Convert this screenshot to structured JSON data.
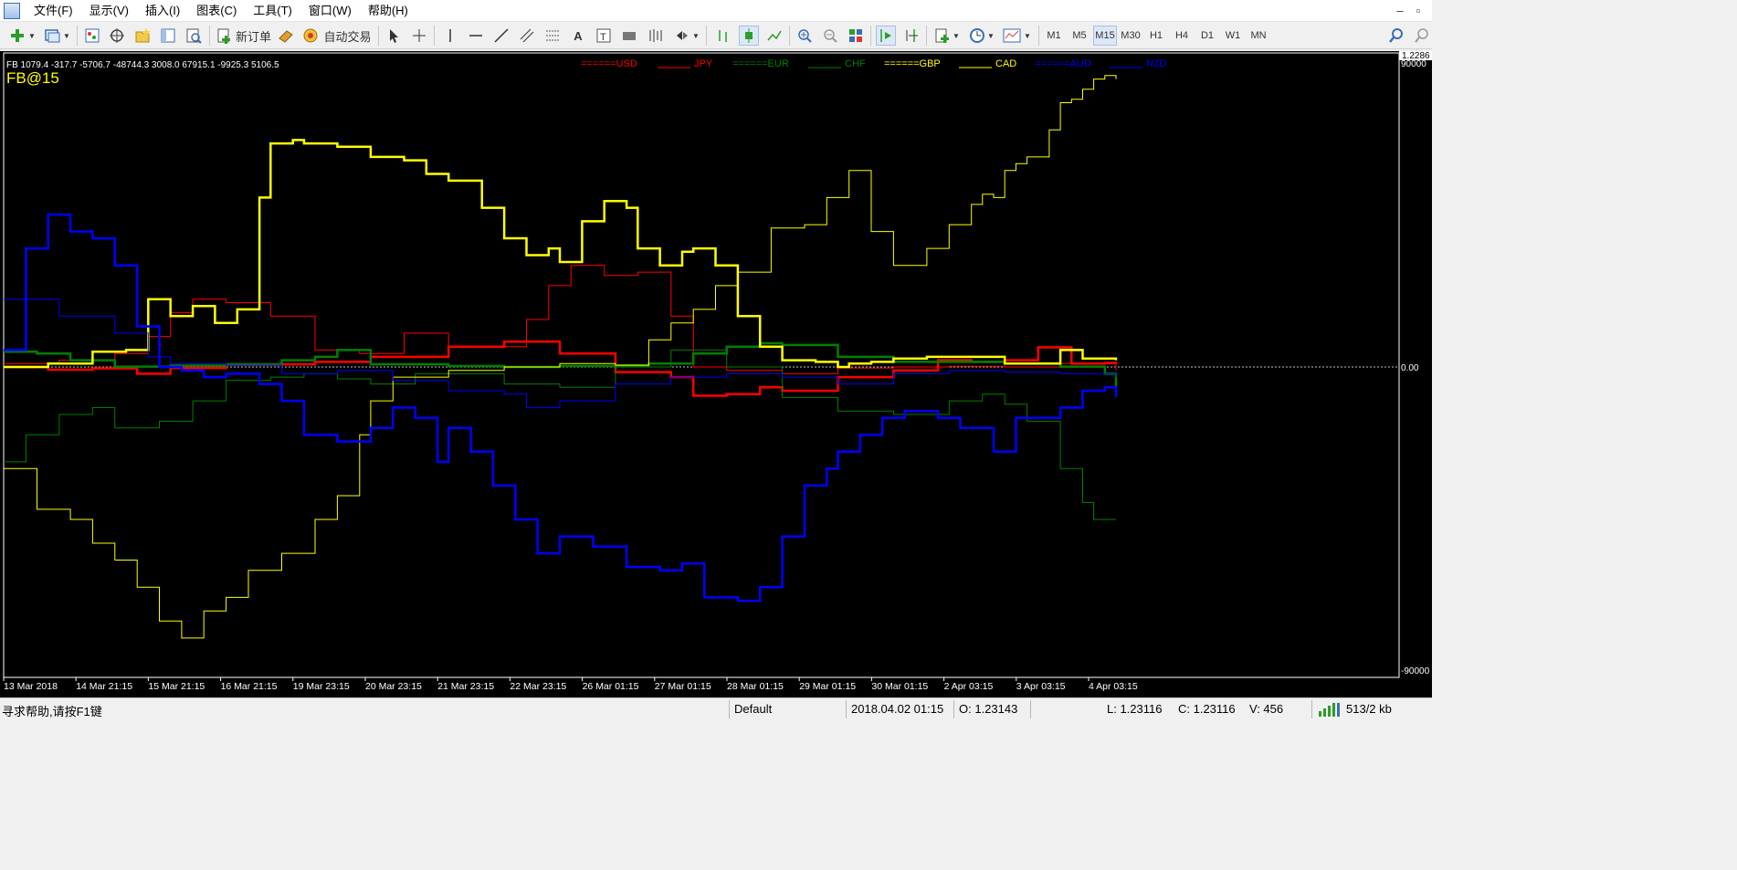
{
  "menus": [
    "文件(F)",
    "显示(V)",
    "插入(I)",
    "图表(C)",
    "工具(T)",
    "窗口(W)",
    "帮助(H)"
  ],
  "window_controls": {
    "minimize": "–",
    "restore": "▫",
    "close": "×"
  },
  "toolbar": {
    "new_order_label": "新订单",
    "auto_trade_label": "自动交易",
    "timeframes": [
      "M1",
      "M5",
      "M15",
      "M30",
      "H1",
      "H4",
      "D1",
      "W1",
      "MN"
    ],
    "active_timeframe": "M15"
  },
  "indicator_header": "FB 1079.4 -317.7 -5706.7 -48744.3 3008.0 67915.1 -9925.3 5106.5",
  "symbol_label": "FB@15",
  "colors": {
    "background": "#000000",
    "usd": "#ff0000",
    "jpy": "#ff0000",
    "eur": "#008000",
    "chf": "#008000",
    "gbp": "#ffff00",
    "cad": "#ffff00",
    "aud": "#0000ff",
    "nzd": "#0000ff",
    "axis_text": "#ffffff"
  },
  "legend": [
    {
      "label": "======USD",
      "color": "#ff0000",
      "style": "marker"
    },
    {
      "label": "JPY",
      "color": "#ff0000",
      "style": "line"
    },
    {
      "label": "======EUR",
      "color": "#008000",
      "style": "marker"
    },
    {
      "label": "CHF",
      "color": "#008000",
      "style": "line"
    },
    {
      "label": "======GBP",
      "color": "#ffff00",
      "style": "marker"
    },
    {
      "label": "CAD",
      "color": "#ffff00",
      "style": "line"
    },
    {
      "label": "======AUD",
      "color": "#0000ff",
      "style": "marker"
    },
    {
      "label": "NZD",
      "color": "#0000ff",
      "style": "line"
    }
  ],
  "price_axis": {
    "top_value": "1.2286",
    "upper": "90000",
    "zero": "0.00",
    "lower": "-90000"
  },
  "chart_data": {
    "type": "line",
    "ylim": [
      -90000,
      90000
    ],
    "x_ticks": [
      "13 Mar 2018",
      "14 Mar 21:15",
      "15 Mar 21:15",
      "16 Mar 21:15",
      "19 Mar 23:15",
      "20 Mar 23:15",
      "21 Mar 23:15",
      "22 Mar 23:15",
      "26 Mar 01:15",
      "27 Mar 01:15",
      "28 Mar 01:15",
      "29 Mar 01:15",
      "30 Mar 01:15",
      "2 Apr 03:15",
      "3 Apr 03:15",
      "4 Apr 03:15"
    ],
    "series": [
      {
        "name": "USD",
        "color": "#ff0000",
        "width": "thick",
        "x": [
          0,
          4,
          8,
          12,
          15,
          20,
          25,
          28,
          33,
          40,
          45,
          50,
          55,
          60,
          62,
          65,
          68,
          70,
          75,
          80,
          84,
          87,
          90,
          93,
          96,
          99,
          100
        ],
        "y": [
          0,
          -800,
          -400,
          -2000,
          -300,
          600,
          800,
          1500,
          3000,
          6000,
          7500,
          4000,
          -1500,
          -3000,
          -8500,
          -8000,
          -6000,
          -7000,
          -3000,
          -1000,
          2000,
          1500,
          2000,
          5800,
          1000,
          1200,
          1000
        ]
      },
      {
        "name": "JPY",
        "color": "#ff0000",
        "width": "thin",
        "x": [
          0,
          5,
          10,
          13,
          15,
          17,
          20,
          24,
          28,
          32,
          36,
          40,
          44,
          47,
          49,
          51,
          54,
          57,
          60,
          62,
          65,
          70,
          75,
          80,
          85,
          90,
          95,
          100
        ],
        "y": [
          1000,
          2000,
          4000,
          9000,
          16000,
          20000,
          19000,
          15000,
          5000,
          4000,
          10000,
          6000,
          6000,
          14000,
          24000,
          30000,
          27000,
          28000,
          15000,
          0,
          -1000,
          -2000,
          -300,
          0,
          200,
          0,
          1000,
          -1000
        ]
      },
      {
        "name": "EUR",
        "color": "#008000",
        "width": "thick",
        "x": [
          0,
          3,
          6,
          10,
          15,
          20,
          25,
          28,
          30,
          33,
          40,
          45,
          50,
          55,
          58,
          62,
          65,
          68,
          70,
          75,
          80,
          85,
          90,
          95,
          99,
          100
        ],
        "y": [
          4500,
          4000,
          2000,
          100,
          400,
          800,
          2000,
          3000,
          5000,
          800,
          300,
          0,
          300,
          500,
          1000,
          4000,
          6000,
          7000,
          6500,
          3000,
          1500,
          1500,
          1000,
          100,
          -2000,
          -6000
        ]
      },
      {
        "name": "CHF",
        "color": "#008000",
        "width": "thin",
        "x": [
          0,
          2,
          5,
          8,
          10,
          14,
          17,
          20,
          24,
          27,
          30,
          33,
          37,
          40,
          45,
          50,
          55,
          60,
          65,
          70,
          75,
          80,
          85,
          88,
          90,
          92,
          95,
          97,
          98,
          100
        ],
        "y": [
          -28000,
          -20000,
          -14000,
          -12000,
          -18000,
          -16000,
          -10000,
          -4000,
          -3000,
          -2000,
          -3500,
          -5000,
          -2000,
          -2000,
          -5000,
          -6000,
          0,
          5000,
          0,
          -9000,
          -13000,
          -14000,
          -10000,
          -8000,
          -11000,
          -16000,
          -30000,
          -40000,
          -45000,
          -45000
        ]
      },
      {
        "name": "GBP",
        "color": "#ffff00",
        "width": "thick",
        "x": [
          0,
          4,
          8,
          11,
          13,
          15,
          17,
          19,
          21,
          23,
          24,
          26,
          27,
          30,
          33,
          36,
          38,
          40,
          43,
          45,
          47,
          49,
          50,
          52,
          54,
          56,
          57,
          59,
          61,
          62,
          64,
          66,
          68,
          70,
          73,
          75,
          76,
          78,
          80,
          83,
          90,
          95,
          97,
          100
        ],
        "y": [
          0,
          1000,
          4500,
          5000,
          20000,
          15000,
          18000,
          13000,
          17000,
          50000,
          66000,
          67000,
          66000,
          65000,
          62000,
          61000,
          57000,
          55000,
          47000,
          38000,
          33000,
          35000,
          31000,
          43000,
          49000,
          47000,
          35000,
          30000,
          34000,
          35000,
          30000,
          15000,
          6000,
          2000,
          1500,
          0,
          1000,
          1500,
          2500,
          3000,
          1000,
          5000,
          2500,
          2000
        ]
      },
      {
        "name": "CAD",
        "color": "#ffff00",
        "width": "thin",
        "x": [
          0,
          3,
          6,
          8,
          10,
          12,
          14,
          16,
          18,
          20,
          22,
          25,
          28,
          30,
          32,
          33,
          35,
          40,
          45,
          50,
          55,
          58,
          60,
          62,
          64,
          66,
          69,
          72,
          74,
          76,
          78,
          80,
          83,
          85,
          87,
          88,
          89,
          90,
          91,
          92,
          94,
          95,
          96,
          97,
          98,
          99,
          100
        ],
        "y": [
          -30000,
          -42000,
          -45000,
          -52000,
          -57000,
          -65000,
          -75000,
          -80000,
          -72000,
          -68000,
          -60000,
          -55000,
          -45000,
          -38000,
          -20000,
          -10000,
          -3000,
          -1000,
          0,
          1000,
          500,
          8000,
          13000,
          17000,
          24000,
          28000,
          41000,
          42000,
          50000,
          58000,
          40000,
          30000,
          35000,
          42000,
          48000,
          51000,
          50000,
          58000,
          60000,
          62000,
          70000,
          78000,
          79000,
          82000,
          85000,
          86000,
          85000
        ]
      },
      {
        "name": "AUD",
        "color": "#0000ff",
        "width": "thick",
        "x": [
          0,
          2,
          4,
          6,
          8,
          10,
          12,
          14,
          16,
          18,
          20,
          23,
          25,
          27,
          30,
          33,
          35,
          37,
          39,
          40,
          42,
          44,
          46,
          48,
          50,
          53,
          56,
          59,
          61,
          63,
          66,
          68,
          70,
          72,
          74,
          75,
          77,
          79,
          81,
          84,
          86,
          89,
          91,
          93,
          95,
          97,
          99,
          100
        ],
        "y": [
          5000,
          35000,
          45000,
          40000,
          38000,
          30000,
          12000,
          0,
          -1000,
          -3000,
          -2000,
          -5000,
          -10000,
          -20000,
          -22000,
          -18000,
          -12000,
          -15000,
          -28000,
          -18000,
          -25000,
          -35000,
          -45000,
          -55000,
          -50000,
          -53000,
          -59000,
          -60000,
          -58000,
          -68000,
          -69000,
          -65000,
          -50000,
          -35000,
          -30000,
          -25000,
          -20000,
          -15000,
          -13000,
          -15000,
          -18000,
          -25000,
          -15000,
          -15000,
          -12000,
          -7000,
          -6000,
          -9000
        ]
      },
      {
        "name": "NZD",
        "color": "#0000ff",
        "width": "thin",
        "x": [
          0,
          5,
          10,
          13,
          15,
          20,
          25,
          30,
          35,
          40,
          45,
          47,
          50,
          55,
          60,
          65,
          70,
          75,
          80,
          85,
          90,
          95,
          100
        ],
        "y": [
          20000,
          15000,
          10000,
          3000,
          1000,
          500,
          -2000,
          -1000,
          -4000,
          -7000,
          -8000,
          -12000,
          -10000,
          -5000,
          -3000,
          -2000,
          -3000,
          -5000,
          -2000,
          -1000,
          -1500,
          -2000,
          -3000
        ]
      }
    ]
  },
  "status": {
    "help": "寻求帮助,请按F1键",
    "profile": "Default",
    "datetime": "2018.04.02 01:15",
    "open": "O: 1.23143",
    "low": "L: 1.23116",
    "close": "C: 1.23116",
    "volume": "V: 456",
    "traffic": "513/2 kb"
  }
}
